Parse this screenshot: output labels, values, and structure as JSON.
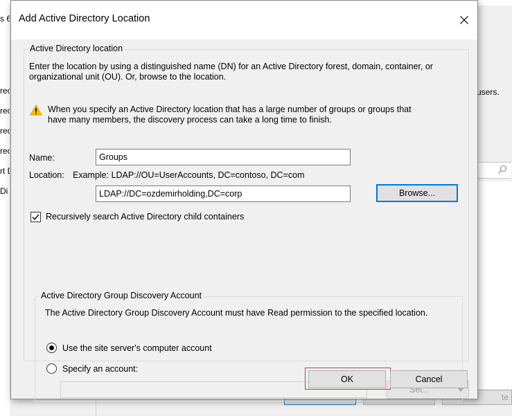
{
  "background": {
    "left_pane_items": [
      "rec",
      "rec",
      "rec",
      "rec",
      "rt D",
      "Di"
    ],
    "left_pane_top": "s 6",
    "right_pane_text": "users.",
    "right_button_label": "te"
  },
  "dialog": {
    "title": "Add Active Directory Location",
    "ad_location_group": {
      "title": "Active Directory location",
      "description": "Enter the location by using a distinguished name (DN) for an Active Directory forest, domain, container, or organizational unit (OU). Or, browse to the location.",
      "description_line1": "Enter the location by using a distinguished name (DN) for an Active Directory forest, domain, container, or",
      "description_line2": "organizational unit (OU). Or, browse to the location.",
      "warning_line1": "When you specify an Active Directory location that has a large number of groups or groups that",
      "warning_line2": "have many members, the discovery process can take a long time to finish.",
      "name_label": "Name:",
      "name_value": "Groups",
      "location_label": "Location:",
      "location_example": "Example: LDAP://OU=UserAccounts, DC=contoso, DC=com",
      "location_value": "LDAP://DC=ozdemirholding,DC=corp",
      "browse_label": "Browse...",
      "recursive_label": "Recursively search Active Directory child containers",
      "recursive_checked": true
    },
    "account_group": {
      "title": "Active Directory Group Discovery Account",
      "description": "The Active Directory Group Discovery Account must have Read permission to the specified location.",
      "option_site_server": "Use the site server's computer account",
      "option_specify": "Specify an account:",
      "selected_option": "site_server",
      "account_value": "",
      "set_label": "Set..."
    },
    "ok_label": "OK",
    "cancel_label": "Cancel"
  },
  "colors": {
    "ok_highlight": "#c04040",
    "browse_border": "#0078d7",
    "warning_yellow": "#f5c400"
  }
}
